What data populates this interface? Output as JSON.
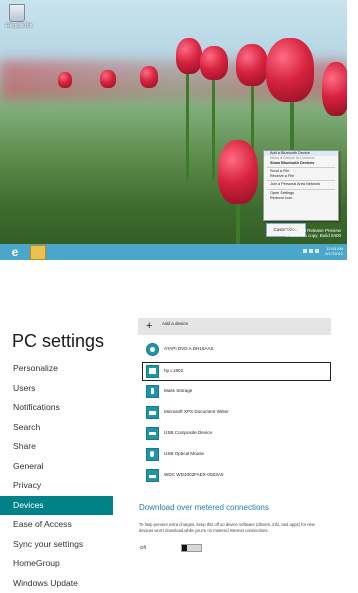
{
  "desktop": {
    "recycle_bin_label": "Recycle Bin",
    "context_menu": [
      "Add a Bluetooth Device",
      "Allow a Device to Connect",
      "Show Bluetooth Devices",
      "Send a File",
      "Receive a File",
      "Join a Personal Area Network",
      "Open Settings",
      "Remove Icon"
    ],
    "customize_label": "Customize...",
    "watermark_line1": "Windows 8 Release Preview",
    "watermark_line2": "Evaluation copy. Build 8400",
    "clock_time": "12:03 AM",
    "clock_date": "6/17/2012"
  },
  "pc_settings": {
    "title": "PC settings",
    "nav": [
      {
        "label": "Personalize",
        "active": false
      },
      {
        "label": "Users",
        "active": false
      },
      {
        "label": "Notifications",
        "active": false
      },
      {
        "label": "Search",
        "active": false
      },
      {
        "label": "Share",
        "active": false
      },
      {
        "label": "General",
        "active": false
      },
      {
        "label": "Privacy",
        "active": false
      },
      {
        "label": "Devices",
        "active": true
      },
      {
        "label": "Ease of Access",
        "active": false
      },
      {
        "label": "Sync your settings",
        "active": false
      },
      {
        "label": "HomeGroup",
        "active": false
      },
      {
        "label": "Windows Update",
        "active": false
      }
    ],
    "add_device_label": "Add a device",
    "devices": [
      {
        "name": "ATAPI DVD A DH16AAS",
        "icon": "disc-drive-icon",
        "selected": false
      },
      {
        "name": "hp L1902",
        "icon": "monitor-icon",
        "selected": true
      },
      {
        "name": "Mass Storage",
        "icon": "usb-storage-icon",
        "selected": false
      },
      {
        "name": "Microsoft XPS Document Writer",
        "icon": "printer-icon",
        "selected": false
      },
      {
        "name": "USB Composite Device",
        "icon": "usb-device-icon",
        "selected": false
      },
      {
        "name": "USB Optical Mouse",
        "icon": "mouse-icon",
        "selected": false
      },
      {
        "name": "WDC WD1002FAEX-00Z3A0",
        "icon": "hard-drive-icon",
        "selected": false
      }
    ],
    "metered_heading": "Download over metered connections",
    "metered_description": "To help prevent extra charges, keep this off so device software (drivers, info, and apps) for new devices won't download while you're on metered Internet connections.",
    "toggle_state_label": "Off",
    "toggle_on": false
  },
  "colors": {
    "accent": "#008288",
    "heading_blue": "#1b7fae",
    "taskbar": "#4aa7c9",
    "device_icon": "#1f94aa"
  }
}
